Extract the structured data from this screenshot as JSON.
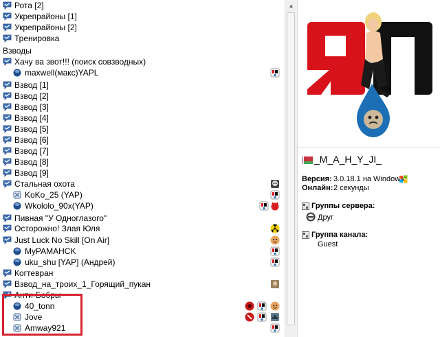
{
  "tree": {
    "rows": [
      {
        "type": "channel",
        "label": "Рота [2]"
      },
      {
        "type": "channel",
        "label": "Укрепрайоны [1]"
      },
      {
        "type": "channel",
        "label": "Укрепрайоны [2]"
      },
      {
        "type": "channel",
        "label": "Тренировка"
      },
      {
        "type": "section",
        "label": "Взводы"
      },
      {
        "type": "channel",
        "label": "Хачу ва звот!!! (поиск совзводных)"
      },
      {
        "type": "user",
        "label": "maxwell(макс)YAPL"
      },
      {
        "type": "channel",
        "label": "Взвод [1]"
      },
      {
        "type": "channel",
        "label": "Взвод [2]"
      },
      {
        "type": "channel",
        "label": "Взвод [3]"
      },
      {
        "type": "channel",
        "label": "Взвод [4]"
      },
      {
        "type": "channel",
        "label": "Взвод [5]"
      },
      {
        "type": "channel",
        "label": "Взвод [6]"
      },
      {
        "type": "channel",
        "label": "Взвод [7]"
      },
      {
        "type": "channel",
        "label": "Взвод [8]"
      },
      {
        "type": "channel",
        "label": "Взвод [9]"
      },
      {
        "type": "channel",
        "label": "Стальная охота"
      },
      {
        "type": "user",
        "label": "KoKo_25 (YAP)"
      },
      {
        "type": "user",
        "label": "Wkololo_90x(YAP)"
      },
      {
        "type": "channel",
        "label": "Пивная \"У Одноглазого\""
      },
      {
        "type": "channel",
        "label": "Осторожно! Злая Юля"
      },
      {
        "type": "channel",
        "label": "Just Luck No Skill [On Air]"
      },
      {
        "type": "user",
        "label": "MyPAMAHCK"
      },
      {
        "type": "user",
        "label": "uku_shu [YAP] (Андрей)"
      },
      {
        "type": "channel",
        "label": "Когтевран"
      },
      {
        "type": "channel",
        "label": "Взвод_на_троих_1_Горящий_пукан"
      },
      {
        "type": "channel",
        "label": "Анти-Бобры"
      },
      {
        "type": "user",
        "label": "40_tonn"
      },
      {
        "type": "user",
        "label": "Jove"
      },
      {
        "type": "user",
        "label": "Amway921"
      }
    ]
  },
  "info": {
    "nickname": "_M_A_H_Y_JI_",
    "version_label": "Версия:",
    "version_value": "3.0.18.1 на Windows",
    "online_label": "Онлайн:",
    "online_value": "2 секунды",
    "server_groups_label": "Группы сервера:",
    "server_group": "Друг",
    "channel_group_label": "Группа канала:",
    "channel_group": "Guest",
    "logo_text": "ЯП"
  },
  "colors": {
    "selection_border": "#d62330",
    "logo_red": "#d8121a",
    "logo_black": "#111111",
    "drop_blue": "#1d6fb5"
  }
}
